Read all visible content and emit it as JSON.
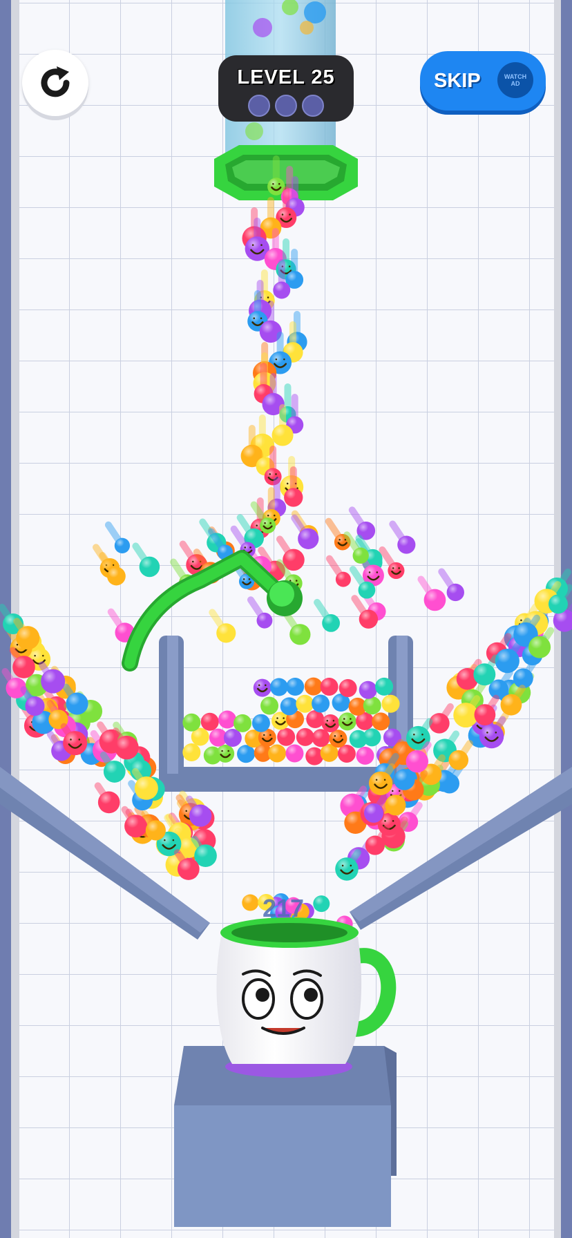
{
  "hud": {
    "level_label": "LEVEL 25",
    "progress_dots": 3,
    "skip_label": "SKIP",
    "watch_ad_label_1": "WATCH",
    "watch_ad_label_2": "AD"
  },
  "game": {
    "ball_count": "217"
  },
  "colors": {
    "background": "#f7f8fc",
    "grid": "#c9cfe0",
    "wall": "#6f83b0",
    "drawn_line": "#36d43f",
    "hud_dark": "#2a2a2e",
    "skip_blue": "#1e86f2",
    "ball_palette": [
      "#ff3d68",
      "#ffb31a",
      "#2c9cf0",
      "#a64df0",
      "#ff4fd0",
      "#7fe13e",
      "#ff7a18",
      "#ffe23a",
      "#22d3b4"
    ]
  },
  "icons": [
    "restart-icon",
    "level-progress-dot",
    "watch-ad-icon",
    "smiley-ball-icon"
  ]
}
